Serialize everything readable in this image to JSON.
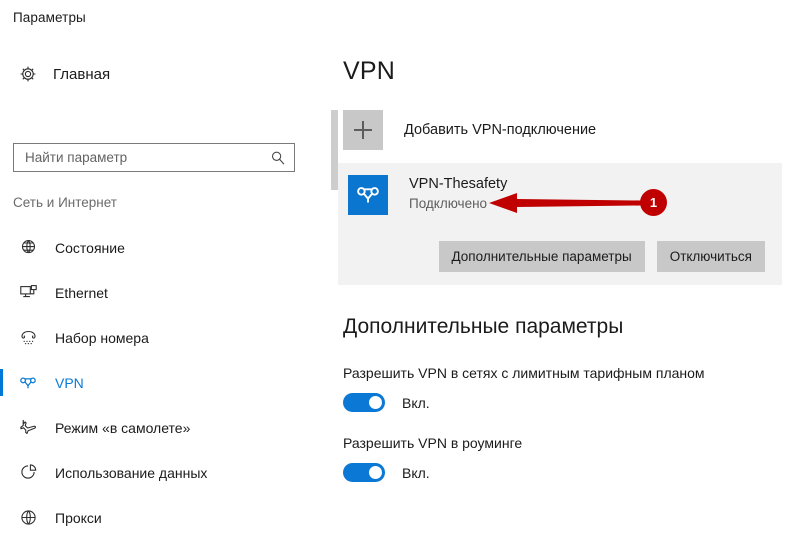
{
  "window": {
    "title": "Параметры"
  },
  "sidebar": {
    "home": {
      "label": "Главная",
      "icon": "gear-icon"
    },
    "search": {
      "value": "",
      "placeholder": "Найти параметр",
      "icon": "search-icon"
    },
    "group_header": "Сеть и Интернет",
    "items": [
      {
        "label": "Состояние",
        "icon": "globe-status-icon",
        "selected": false
      },
      {
        "label": "Ethernet",
        "icon": "ethernet-icon",
        "selected": false
      },
      {
        "label": "Набор номера",
        "icon": "dialup-icon",
        "selected": false
      },
      {
        "label": "VPN",
        "icon": "vpn-icon",
        "selected": true
      },
      {
        "label": "Режим «в самолете»",
        "icon": "airplane-icon",
        "selected": false
      },
      {
        "label": "Использование данных",
        "icon": "data-usage-icon",
        "selected": false
      },
      {
        "label": "Прокси",
        "icon": "proxy-globe-icon",
        "selected": false
      }
    ]
  },
  "main": {
    "page_title": "VPN",
    "add_connection": {
      "label": "Добавить VPN-подключение",
      "icon": "plus-icon"
    },
    "connection": {
      "name": "VPN-Thesafety",
      "status": "Подключено",
      "icon": "vpn-connection-icon",
      "buttons": {
        "advanced": "Дополнительные параметры",
        "disconnect": "Отключиться"
      }
    },
    "advanced": {
      "title": "Дополнительные параметры",
      "options": [
        {
          "label": "Разрешить VPN в сетях с лимитным тарифным планом",
          "state": "Вкл.",
          "on": true
        },
        {
          "label": "Разрешить VPN в роуминге",
          "state": "Вкл.",
          "on": true
        }
      ]
    }
  },
  "annotation": {
    "badge_number": "1",
    "color": "#c00000"
  },
  "colors": {
    "accent": "#0078d7",
    "card_bg": "#f2f2f2",
    "button_bg": "#c8c8c8",
    "annotation_red": "#c00000"
  }
}
